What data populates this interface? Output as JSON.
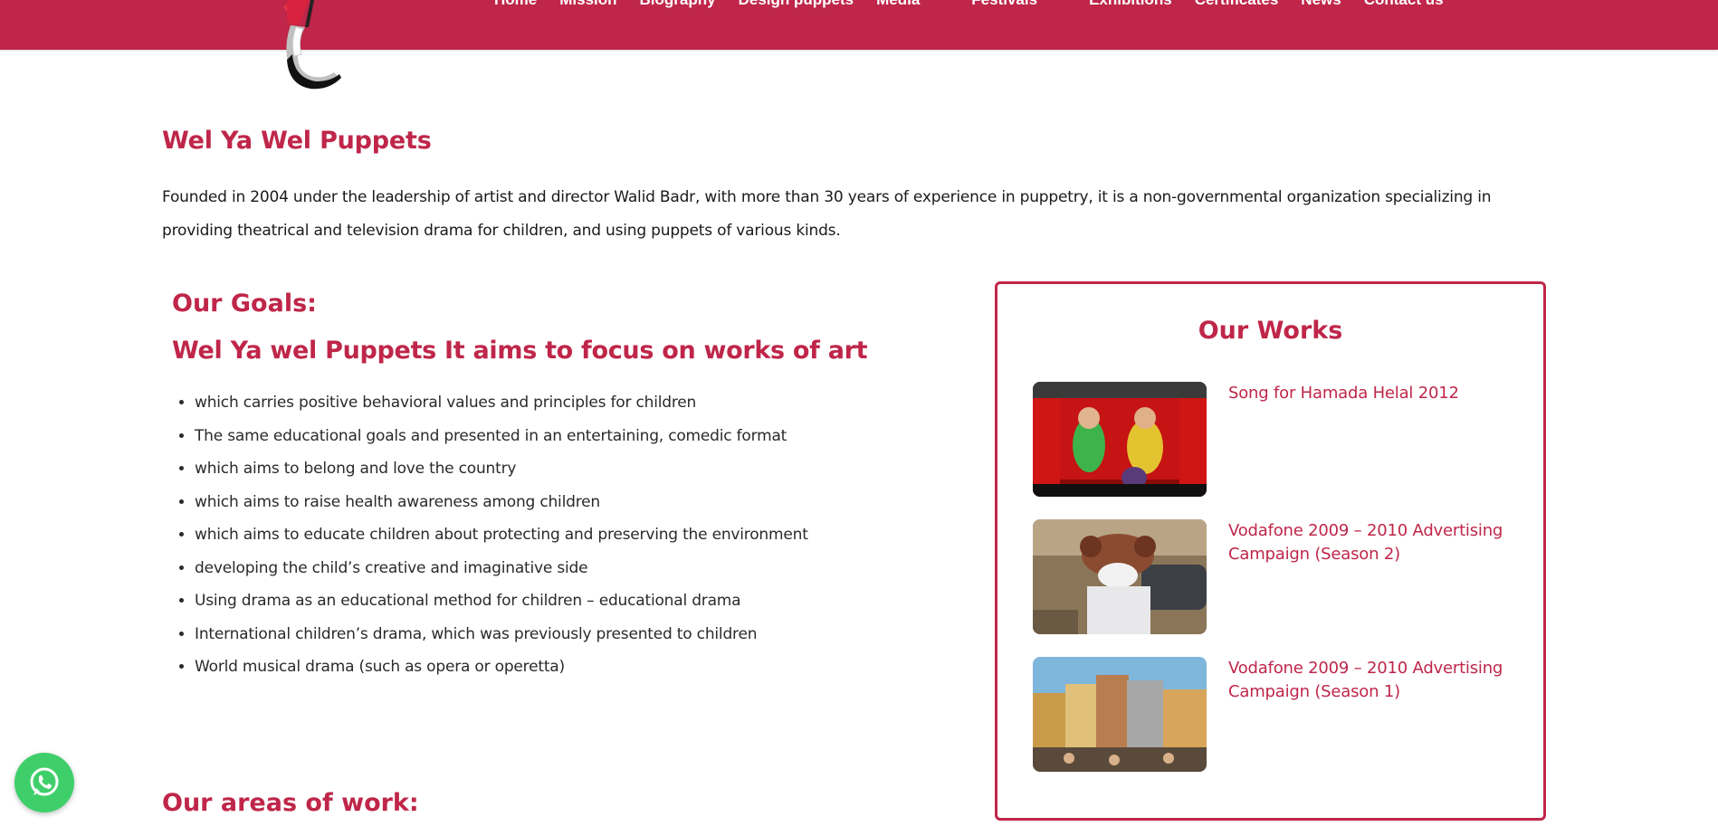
{
  "nav": {
    "items": [
      "Home",
      "Mission",
      "Biography",
      "Design puppets",
      "Media",
      "Festivals",
      "Exhibitions",
      "Certificates",
      "News",
      "Contact us"
    ]
  },
  "colors": {
    "brand": "#bf2649",
    "whatsapp": "#3fcf6a"
  },
  "main": {
    "title": "Wel Ya Wel Puppets",
    "intro": "Founded in 2004 under the leadership of artist and director Walid Badr, with more than 30 years of experience in puppetry, it is a non-governmental organization specializing in providing theatrical and television drama for children, and using puppets of various kinds.",
    "goals_title": "Our Goals:",
    "goals_subtitle": "Wel Ya wel Puppets It aims to focus on works of art",
    "goals": [
      "which carries positive behavioral values and principles for children",
      "The same educational goals and presented in an entertaining, comedic format",
      "which aims to belong and love the country",
      "which aims to raise health awareness among children",
      "which aims to educate children about protecting and preserving the environment",
      "developing the child’s creative and imaginative side",
      "Using drama as an educational method for children – educational drama",
      "International children’s drama, which was previously presented to children",
      "World musical drama (such as opera or operetta)"
    ],
    "areas_title": "Our areas of work:"
  },
  "works": {
    "title": "Our Works",
    "items": [
      {
        "title": "Song for Hamada Helal 2012",
        "thumb": "stage-performance-thumbnail"
      },
      {
        "title": "Vodafone 2009 – 2010 Advertising Campaign (Season 2)",
        "thumb": "puppet-street-thumbnail"
      },
      {
        "title": "Vodafone 2009 – 2010 Advertising Campaign (Season 1)",
        "thumb": "city-set-thumbnail"
      }
    ]
  },
  "whatsapp": {
    "icon": "whatsapp-icon"
  }
}
